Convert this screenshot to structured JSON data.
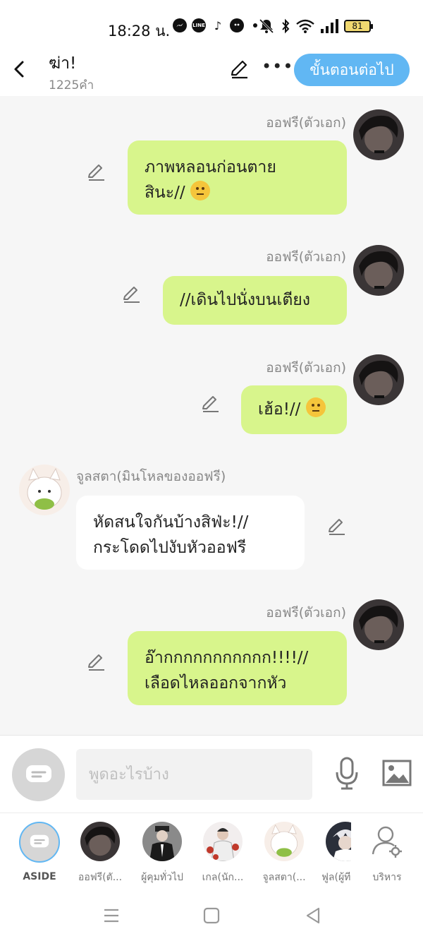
{
  "status_bar": {
    "time": "18:28 น.",
    "battery": "81",
    "icons": [
      "messenger-icon",
      "line-icon",
      "tiktok-icon",
      "bird-app-icon",
      "dot-icon",
      "mute-icon",
      "bluetooth-icon",
      "wifi-icon",
      "signal-icon"
    ]
  },
  "header": {
    "title": "ฆ่า!",
    "word_count": "1225คำ",
    "next_button": "ขั้นตอนต่อไป"
  },
  "messages": [
    {
      "sender": "ออฟรี(ตัวเอก)",
      "side": "right",
      "lines": [
        "ภาพหลอนก่อนตาย",
        "สินะ//"
      ],
      "emoji": "neutral-face-emoji"
    },
    {
      "sender": "ออฟรี(ตัวเอก)",
      "side": "right",
      "lines": [
        "//เดินไปนั่งบนเตียง"
      ]
    },
    {
      "sender": "ออฟรี(ตัวเอก)",
      "side": "right",
      "lines": [
        "เฮ้อ!//"
      ],
      "emoji": "sighing-face-emoji"
    },
    {
      "sender": "จูลสตา(มินโหลของออฟรี)",
      "side": "left",
      "lines": [
        "หัดสนใจกันบ้างสิฟ่ะ!//",
        "กระโดดไปงับหัวออฟรี"
      ]
    },
    {
      "sender": "ออฟรี(ตัวเอก)",
      "side": "right",
      "lines": [
        "อ๊ากกกกกกกกกกก!!!!//",
        "เลือดไหลออกจากหัว"
      ]
    }
  ],
  "input": {
    "placeholder": "พูดอะไรบ้าง"
  },
  "characters": [
    {
      "label": "ASIDE"
    },
    {
      "label": "ออฟรี(ตั..."
    },
    {
      "label": "ผู้คุมทั่วไป"
    },
    {
      "label": "เกล(นัก..."
    },
    {
      "label": "จูลสตา(..."
    },
    {
      "label": "ฟูล(ผู้ที"
    },
    {
      "label": "บริหาร"
    }
  ],
  "colors": {
    "accent": "#61b7f3",
    "my_bubble": "#d8f58c",
    "their_bubble": "#ffffff",
    "background": "#f6f6f6"
  }
}
